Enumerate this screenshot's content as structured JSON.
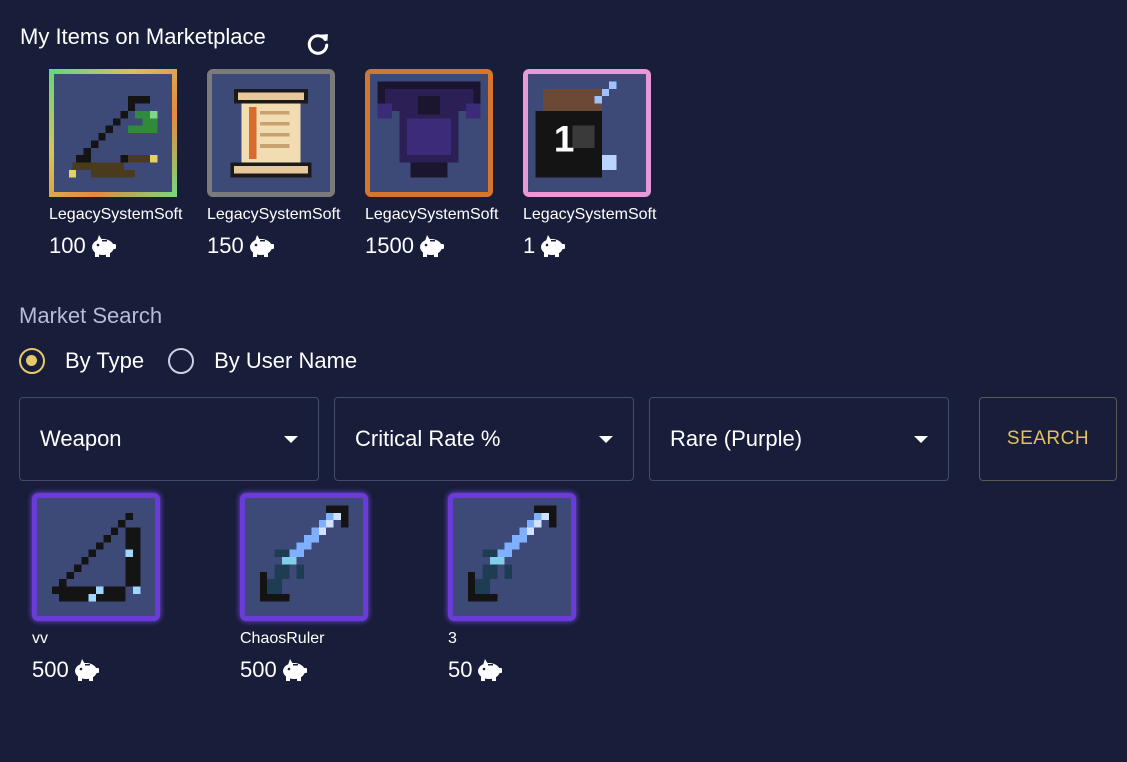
{
  "header": {
    "title": "My Items on Marketplace",
    "refresh_icon": "refresh-icon"
  },
  "my_items": [
    {
      "name": "LegacySystemSoft",
      "price": "100",
      "rarity_color": "#b8a04a",
      "item": "bow"
    },
    {
      "name": "LegacySystemSoft",
      "price": "150",
      "rarity_color": "#7b7b7b",
      "item": "scroll"
    },
    {
      "name": "LegacySystemSoft",
      "price": "1500",
      "rarity_color": "#d6762d",
      "item": "armor"
    },
    {
      "name": "LegacySystemSoft",
      "price": "1",
      "rarity_color": "#e79ad7",
      "item": "character",
      "badge": "1"
    }
  ],
  "search": {
    "title": "Market Search",
    "mode_options": [
      {
        "label": "By Type",
        "selected": true
      },
      {
        "label": "By User Name",
        "selected": false
      }
    ],
    "filters": {
      "type": "Weapon",
      "stat": "Critical Rate %",
      "rarity": "Rare (Purple)"
    },
    "button_label": "SEARCH",
    "accent_color": "#e7c86a"
  },
  "results": [
    {
      "name": "vv",
      "price": "500",
      "rarity_color": "#6a3bd6",
      "item": "bow"
    },
    {
      "name": "ChaosRuler",
      "price": "500",
      "rarity_color": "#6a3bd6",
      "item": "sword"
    },
    {
      "name": "3",
      "price": "50",
      "rarity_color": "#6a3bd6",
      "item": "sword"
    }
  ],
  "currency_icon": "piggy-bank-icon"
}
